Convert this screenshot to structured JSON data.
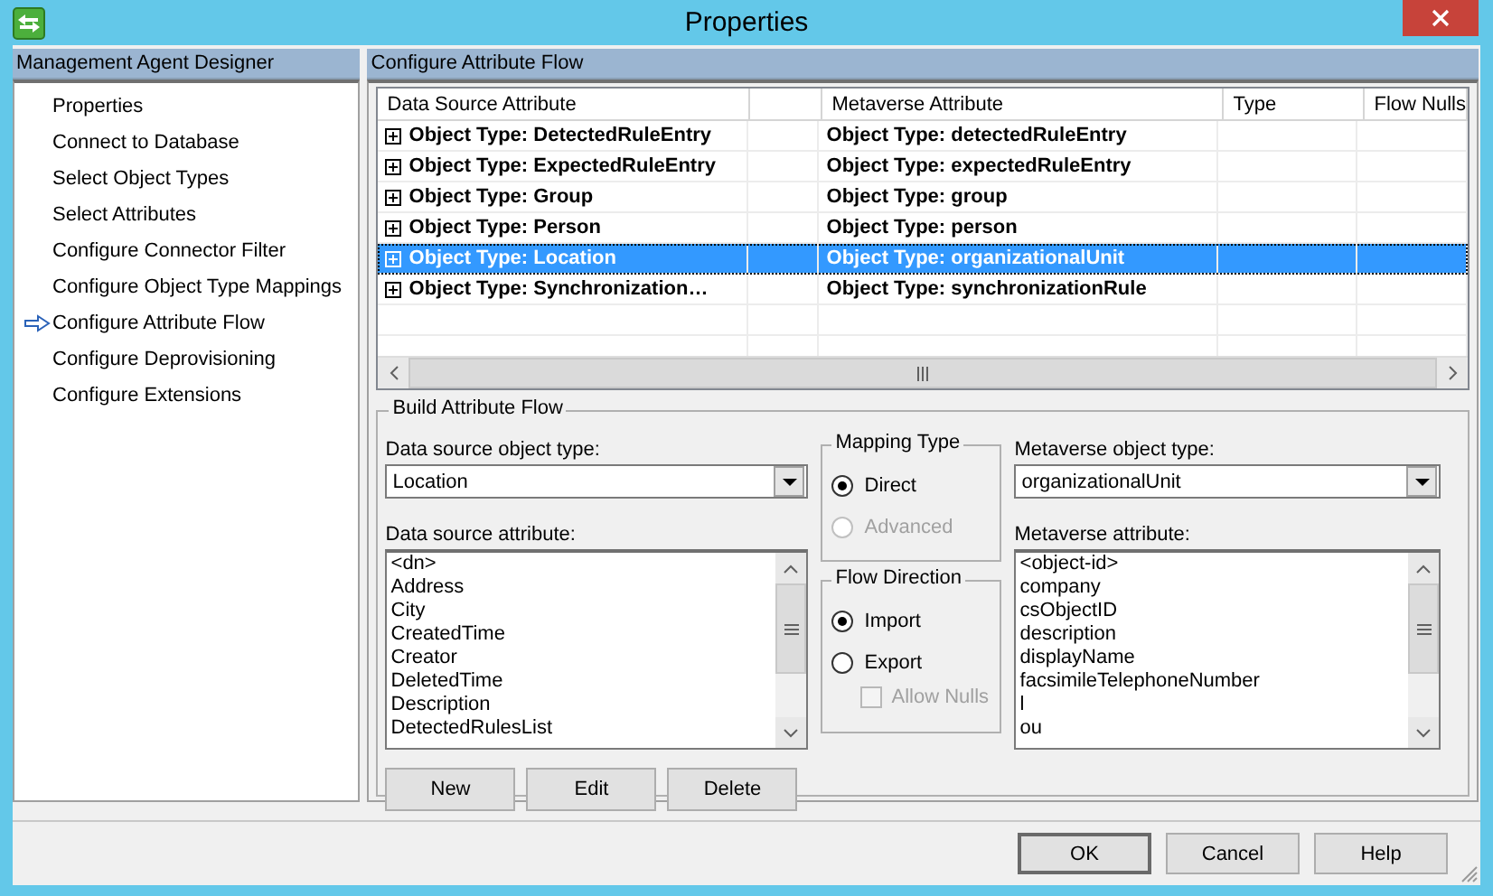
{
  "window": {
    "title": "Properties"
  },
  "sidebar": {
    "title": "Management Agent Designer",
    "items": [
      {
        "label": "Properties",
        "selected": false
      },
      {
        "label": "Connect to Database",
        "selected": false
      },
      {
        "label": "Select Object Types",
        "selected": false
      },
      {
        "label": "Select Attributes",
        "selected": false
      },
      {
        "label": "Configure Connector Filter",
        "selected": false
      },
      {
        "label": "Configure Object Type Mappings",
        "selected": false
      },
      {
        "label": "Configure Attribute Flow",
        "selected": true
      },
      {
        "label": "Configure Deprovisioning",
        "selected": false
      },
      {
        "label": "Configure Extensions",
        "selected": false
      }
    ]
  },
  "panel": {
    "title": "Configure Attribute Flow"
  },
  "grid": {
    "columns": [
      "Data Source Attribute",
      "Metaverse Attribute",
      "Type",
      "Flow Nulls"
    ],
    "rows": [
      {
        "source": "Object Type: DetectedRuleEntry",
        "target": "Object Type: detectedRuleEntry",
        "expanded": false,
        "selected": false
      },
      {
        "source": "Object Type: ExpectedRuleEntry",
        "target": "Object Type: expectedRuleEntry",
        "expanded": false,
        "selected": false
      },
      {
        "source": "Object Type: Group",
        "target": "Object Type: group",
        "expanded": false,
        "selected": false
      },
      {
        "source": "Object Type: Person",
        "target": "Object Type: person",
        "expanded": false,
        "selected": false
      },
      {
        "source": "Object Type: Location",
        "target": "Object Type: organizationalUnit",
        "expanded": false,
        "selected": true
      },
      {
        "source": "Object Type: Synchronization…",
        "target": "Object Type: synchronizationRule",
        "expanded": false,
        "selected": false
      }
    ]
  },
  "build": {
    "title": "Build Attribute Flow",
    "source_type": {
      "label": "Data source object type:",
      "value": "Location"
    },
    "source_attribute": {
      "label": "Data source attribute:",
      "items": [
        "<dn>",
        "Address",
        "City",
        "CreatedTime",
        "Creator",
        "DeletedTime",
        "Description",
        "DetectedRulesList"
      ]
    },
    "mapping_type": {
      "title": "Mapping Type",
      "options": [
        {
          "label": "Direct",
          "selected": true,
          "disabled": false
        },
        {
          "label": "Advanced",
          "selected": false,
          "disabled": true
        }
      ]
    },
    "flow_direction": {
      "title": "Flow Direction",
      "options": [
        {
          "label": "Import",
          "selected": true,
          "disabled": false
        },
        {
          "label": "Export",
          "selected": false,
          "disabled": false
        }
      ],
      "allow_nulls": {
        "label": "Allow Nulls",
        "checked": false,
        "disabled": true
      }
    },
    "metaverse_type": {
      "label": "Metaverse object type:",
      "value": "organizationalUnit"
    },
    "metaverse_attribute": {
      "label": "Metaverse attribute:",
      "items": [
        "<object-id>",
        "company",
        "csObjectID",
        "description",
        "displayName",
        "facsimileTelephoneNumber",
        "l",
        "ou"
      ]
    },
    "buttons": [
      "New",
      "Edit",
      "Delete"
    ]
  },
  "footer_buttons": [
    {
      "label": "OK",
      "default": true
    },
    {
      "label": "Cancel",
      "default": false
    },
    {
      "label": "Help",
      "default": false
    }
  ]
}
